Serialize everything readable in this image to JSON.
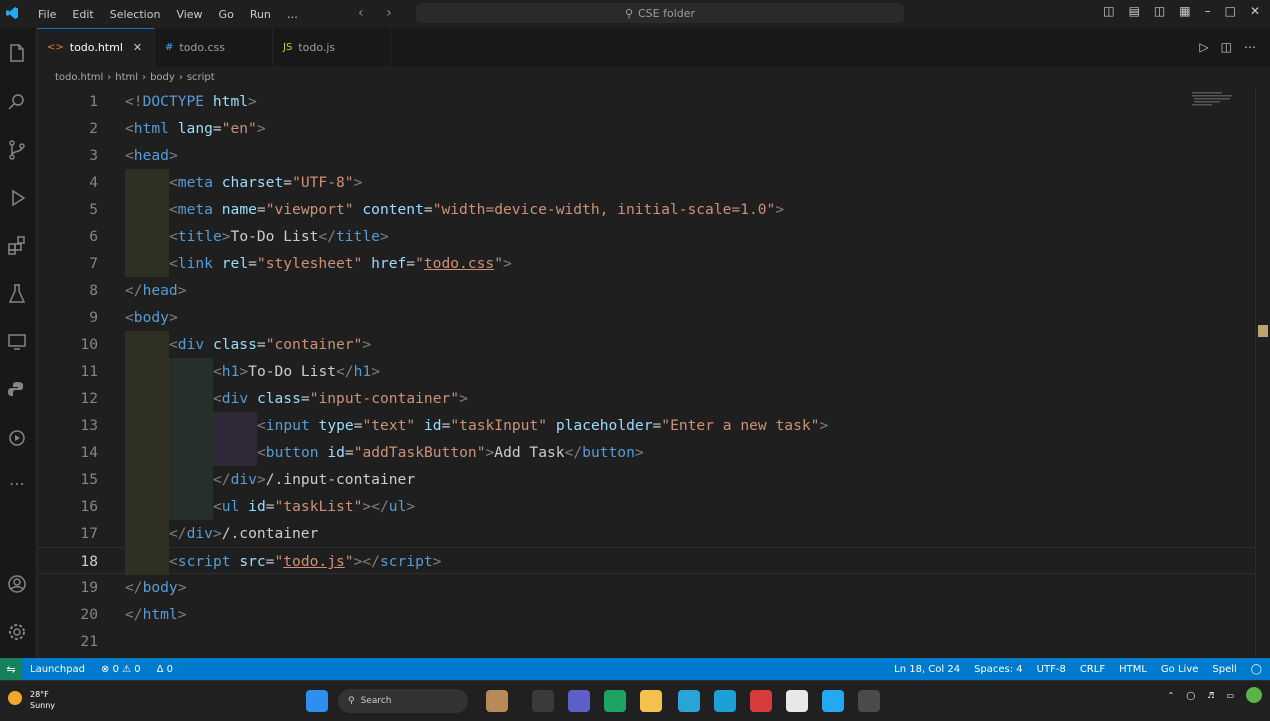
{
  "titlebar": {
    "menu": [
      "File",
      "Edit",
      "Selection",
      "View",
      "Go",
      "Run",
      "…"
    ],
    "search_placeholder": "CSE folder"
  },
  "tabs": [
    {
      "label": "todo.html",
      "active": true
    },
    {
      "label": "todo.css",
      "active": false
    },
    {
      "label": "todo.js",
      "active": false
    }
  ],
  "breadcrumb": [
    "todo.html",
    "html",
    "body",
    "script"
  ],
  "editor": {
    "current_line": 18,
    "lines": [
      {
        "n": "1",
        "indent": 0,
        "tokens": [
          [
            "p",
            "<!"
          ],
          [
            "t",
            "DOCTYPE"
          ],
          [
            "x",
            " "
          ],
          [
            "a",
            "html"
          ],
          [
            "p",
            ">"
          ]
        ]
      },
      {
        "n": "2",
        "indent": 0,
        "tokens": [
          [
            "p",
            "<"
          ],
          [
            "t",
            "html"
          ],
          [
            "x",
            " "
          ],
          [
            "a",
            "lang"
          ],
          [
            "x",
            "="
          ],
          [
            "s",
            "\"en\""
          ],
          [
            "p",
            ">"
          ]
        ]
      },
      {
        "n": "3",
        "indent": 0,
        "tokens": [
          [
            "p",
            "<"
          ],
          [
            "t",
            "head"
          ],
          [
            "p",
            ">"
          ]
        ]
      },
      {
        "n": "4",
        "indent": 1,
        "tokens": [
          [
            "p",
            "<"
          ],
          [
            "t",
            "meta"
          ],
          [
            "x",
            " "
          ],
          [
            "a",
            "charset"
          ],
          [
            "x",
            "="
          ],
          [
            "s",
            "\"UTF-8\""
          ],
          [
            "p",
            ">"
          ]
        ]
      },
      {
        "n": "5",
        "indent": 1,
        "tokens": [
          [
            "p",
            "<"
          ],
          [
            "t",
            "meta"
          ],
          [
            "x",
            " "
          ],
          [
            "a",
            "name"
          ],
          [
            "x",
            "="
          ],
          [
            "s",
            "\"viewport\""
          ],
          [
            "x",
            " "
          ],
          [
            "a",
            "content"
          ],
          [
            "x",
            "="
          ],
          [
            "s",
            "\"width=device-width, initial-scale=1.0\""
          ],
          [
            "p",
            ">"
          ]
        ]
      },
      {
        "n": "6",
        "indent": 1,
        "tokens": [
          [
            "p",
            "<"
          ],
          [
            "t",
            "title"
          ],
          [
            "p",
            ">"
          ],
          [
            "x",
            "To-Do List"
          ],
          [
            "p",
            "</"
          ],
          [
            "t",
            "title"
          ],
          [
            "p",
            ">"
          ]
        ]
      },
      {
        "n": "7",
        "indent": 1,
        "tokens": [
          [
            "p",
            "<"
          ],
          [
            "t",
            "link"
          ],
          [
            "x",
            " "
          ],
          [
            "a",
            "rel"
          ],
          [
            "x",
            "="
          ],
          [
            "s",
            "\"stylesheet\""
          ],
          [
            "x",
            " "
          ],
          [
            "a",
            "href"
          ],
          [
            "x",
            "="
          ],
          [
            "s",
            "\""
          ],
          [
            "su",
            "todo.css"
          ],
          [
            "s",
            "\""
          ],
          [
            "p",
            ">"
          ]
        ]
      },
      {
        "n": "8",
        "indent": 0,
        "tokens": [
          [
            "p",
            "</"
          ],
          [
            "t",
            "head"
          ],
          [
            "p",
            ">"
          ]
        ]
      },
      {
        "n": "9",
        "indent": 0,
        "tokens": [
          [
            "p",
            "<"
          ],
          [
            "t",
            "body"
          ],
          [
            "p",
            ">"
          ]
        ]
      },
      {
        "n": "10",
        "indent": 1,
        "tokens": [
          [
            "p",
            "<"
          ],
          [
            "t",
            "div"
          ],
          [
            "x",
            " "
          ],
          [
            "a",
            "class"
          ],
          [
            "x",
            "="
          ],
          [
            "s",
            "\"container\""
          ],
          [
            "p",
            ">"
          ]
        ]
      },
      {
        "n": "11",
        "indent": 2,
        "tokens": [
          [
            "p",
            "<"
          ],
          [
            "t",
            "h1"
          ],
          [
            "p",
            ">"
          ],
          [
            "x",
            "To-Do List"
          ],
          [
            "p",
            "</"
          ],
          [
            "t",
            "h1"
          ],
          [
            "p",
            ">"
          ]
        ]
      },
      {
        "n": "12",
        "indent": 2,
        "tokens": [
          [
            "p",
            "<"
          ],
          [
            "t",
            "div"
          ],
          [
            "x",
            " "
          ],
          [
            "a",
            "class"
          ],
          [
            "x",
            "="
          ],
          [
            "s",
            "\"input-container\""
          ],
          [
            "p",
            ">"
          ]
        ]
      },
      {
        "n": "13",
        "indent": 3,
        "tokens": [
          [
            "p",
            "<"
          ],
          [
            "t",
            "input"
          ],
          [
            "x",
            " "
          ],
          [
            "a",
            "type"
          ],
          [
            "x",
            "="
          ],
          [
            "s",
            "\"text\""
          ],
          [
            "x",
            " "
          ],
          [
            "a",
            "id"
          ],
          [
            "x",
            "="
          ],
          [
            "s",
            "\"taskInput\""
          ],
          [
            "x",
            " "
          ],
          [
            "a",
            "placeholder"
          ],
          [
            "x",
            "="
          ],
          [
            "s",
            "\"Enter a new task\""
          ],
          [
            "p",
            ">"
          ]
        ]
      },
      {
        "n": "14",
        "indent": 3,
        "tokens": [
          [
            "p",
            "<"
          ],
          [
            "t",
            "button"
          ],
          [
            "x",
            " "
          ],
          [
            "a",
            "id"
          ],
          [
            "x",
            "="
          ],
          [
            "s",
            "\"addTaskButton\""
          ],
          [
            "p",
            ">"
          ],
          [
            "x",
            "Add Task"
          ],
          [
            "p",
            "</"
          ],
          [
            "t",
            "button"
          ],
          [
            "p",
            ">"
          ]
        ]
      },
      {
        "n": "15",
        "indent": 2,
        "tokens": [
          [
            "p",
            "</"
          ],
          [
            "t",
            "div"
          ],
          [
            "p",
            ">"
          ],
          [
            "x",
            "/.input-container"
          ]
        ]
      },
      {
        "n": "16",
        "indent": 2,
        "tokens": [
          [
            "p",
            "<"
          ],
          [
            "t",
            "ul"
          ],
          [
            "x",
            " "
          ],
          [
            "a",
            "id"
          ],
          [
            "x",
            "="
          ],
          [
            "s",
            "\"taskList\""
          ],
          [
            "p",
            "></"
          ],
          [
            "t",
            "ul"
          ],
          [
            "p",
            ">"
          ]
        ]
      },
      {
        "n": "17",
        "indent": 1,
        "tokens": [
          [
            "p",
            "</"
          ],
          [
            "t",
            "div"
          ],
          [
            "p",
            ">"
          ],
          [
            "x",
            "/.container"
          ]
        ]
      },
      {
        "n": "18",
        "indent": 1,
        "tokens": [
          [
            "p",
            "<"
          ],
          [
            "t",
            "script"
          ],
          [
            "x",
            " "
          ],
          [
            "a",
            "src"
          ],
          [
            "x",
            "="
          ],
          [
            "s",
            "\""
          ],
          [
            "su",
            "todo.js"
          ],
          [
            "s",
            "\""
          ],
          [
            "p",
            "></"
          ],
          [
            "t",
            "script"
          ],
          [
            "p",
            ">"
          ]
        ]
      },
      {
        "n": "19",
        "indent": 0,
        "tokens": [
          [
            "p",
            "</"
          ],
          [
            "t",
            "body"
          ],
          [
            "p",
            ">"
          ]
        ]
      },
      {
        "n": "20",
        "indent": 0,
        "tokens": [
          [
            "p",
            "</"
          ],
          [
            "t",
            "html"
          ],
          [
            "p",
            ">"
          ]
        ]
      },
      {
        "n": "21",
        "indent": 0,
        "tokens": []
      }
    ]
  },
  "statusbar": {
    "left": [
      "Launchpad",
      "⊗ 0 ⚠ 0",
      "Δ 0"
    ],
    "right": [
      "Ln 18, Col 24",
      "Spaces: 4",
      "UTF-8",
      "CRLF",
      "HTML",
      "Go Live",
      "Spell"
    ]
  },
  "taskbar": {
    "weather": [
      "28°F",
      "Sunny"
    ],
    "search": "Search"
  },
  "colors": {
    "accent": "#007acc",
    "background": "#1f1f1f",
    "tag": "#569cd6",
    "attr": "#9cdcfe",
    "string": "#ce9178"
  }
}
